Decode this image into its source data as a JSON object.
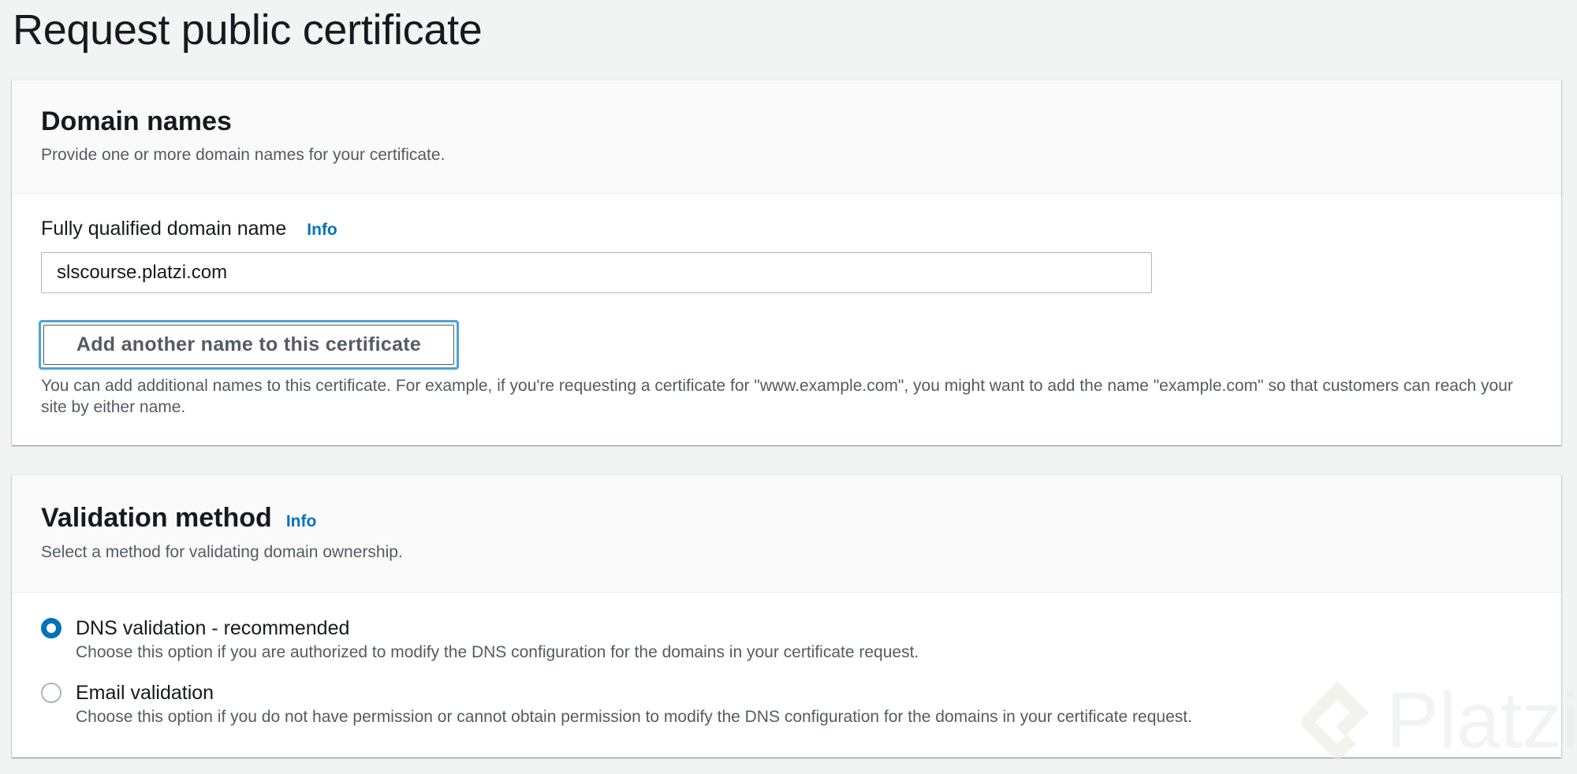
{
  "page": {
    "title": "Request public certificate"
  },
  "domain_names": {
    "heading": "Domain names",
    "description": "Provide one or more domain names for your certificate.",
    "field_label": "Fully qualified domain name",
    "info_label": "Info",
    "input_value": "slscourse.platzi.com",
    "add_button_label": "Add another name to this certificate",
    "helper_text": "You can add additional names to this certificate. For example, if you're requesting a certificate for \"www.example.com\", you might want to add the name \"example.com\" so that customers can reach your site by either name."
  },
  "validation_method": {
    "heading": "Validation method",
    "info_label": "Info",
    "description": "Select a method for validating domain ownership.",
    "options": [
      {
        "title": "DNS validation - recommended",
        "description": "Choose this option if you are authorized to modify the DNS configuration for the domains in your certificate request.",
        "selected": true
      },
      {
        "title": "Email validation",
        "description": "Choose this option if you do not have permission or cannot obtain permission to modify the DNS configuration for the domains in your certificate request.",
        "selected": false
      }
    ]
  },
  "watermark": {
    "text": "Platzi",
    "logo_icon": "platzi-logo-icon"
  },
  "colors": {
    "accent": "#0073bb",
    "focus_ring": "#4ba4d4",
    "background": "#f2f3f3",
    "text_primary": "#16191f",
    "text_secondary": "#545b64"
  }
}
